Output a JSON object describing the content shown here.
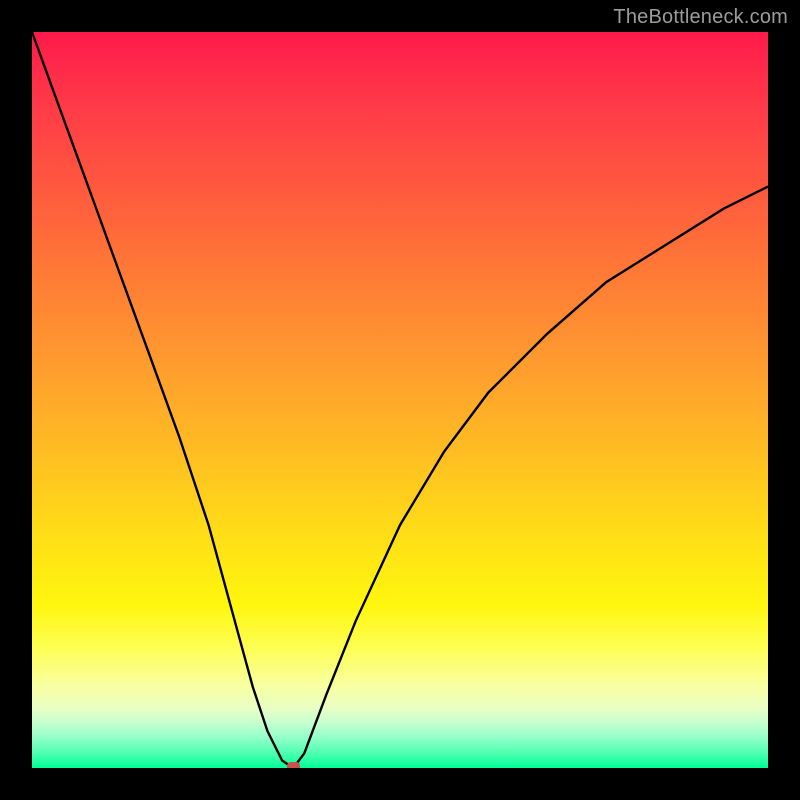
{
  "watermark": "TheBottleneck.com",
  "colors": {
    "frame": "#000000",
    "curve": "#000000",
    "marker": "#c9524f",
    "gradient_top": "#ff1a4b",
    "gradient_bottom": "#00ff99"
  },
  "chart_data": {
    "type": "line",
    "title": "",
    "xlabel": "",
    "ylabel": "",
    "xlim": [
      0,
      100
    ],
    "ylim": [
      0,
      100
    ],
    "notes": "V-shaped bottleneck curve on rainbow heat gradient. Values estimated from pixel positions (no tick labels present).",
    "series": [
      {
        "name": "bottleneck-curve",
        "x": [
          0,
          4,
          8,
          12,
          16,
          20,
          24,
          27,
          30,
          32,
          34,
          35.5,
          37,
          40,
          44,
          50,
          56,
          62,
          70,
          78,
          86,
          94,
          100
        ],
        "y": [
          100,
          89,
          78,
          67,
          56,
          45,
          33,
          22,
          11,
          5,
          1,
          0,
          2,
          10,
          20,
          33,
          43,
          51,
          59,
          66,
          71,
          76,
          79
        ]
      }
    ],
    "marker": {
      "x": 35.5,
      "y": 0
    },
    "axes_visible": false,
    "grid": false
  }
}
